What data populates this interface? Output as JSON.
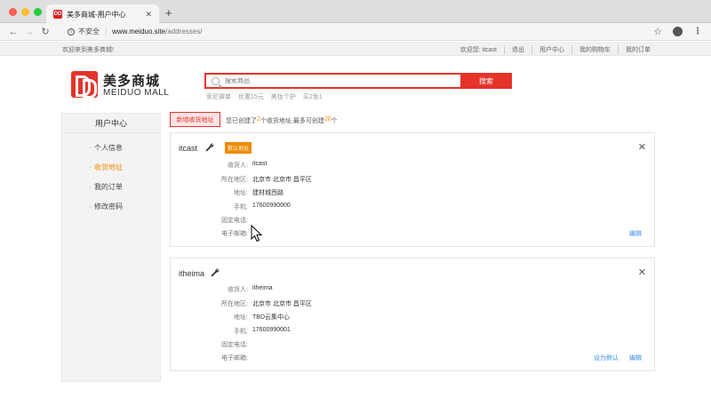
{
  "browser": {
    "tab_title": "美多商城-用户中心",
    "favicon_text": "DD",
    "insecure_label": "不安全",
    "url_host": "www.meiduo.site",
    "url_path": "/addresses/"
  },
  "topbar": {
    "welcome": "欢迎来到美多商城!",
    "greeting": "欢迎您: itcast",
    "logout": "退出",
    "user_center": "用户中心",
    "cart": "我的购物车",
    "orders": "我的订单"
  },
  "header": {
    "logo_cn": "美多商城",
    "logo_en": "MEIDUO MALL",
    "search_placeholder": "搜索商品",
    "search_button": "搜索",
    "hot_words": [
      "索尼微单",
      "优惠15元",
      "美妆个护",
      "买2免1"
    ]
  },
  "sidebar": {
    "title": "用户中心",
    "items": [
      {
        "label": "个人信息",
        "active": false
      },
      {
        "label": "收货地址",
        "active": true
      },
      {
        "label": "我的订单",
        "active": false
      },
      {
        "label": "修改密码",
        "active": false
      }
    ]
  },
  "main": {
    "add_button": "新增收货地址",
    "count_prefix": "您已创建了",
    "count_value": "2",
    "count_middle": "个收货地址,最多可创建",
    "count_max": "20",
    "count_suffix": "个"
  },
  "addresses": [
    {
      "name": "itcast",
      "default_badge": "默认地址",
      "labels": [
        "收货人:",
        "所在地区:",
        "地址:",
        "手机:",
        "固定电话:",
        "电子邮箱:"
      ],
      "values": [
        "itcast",
        "北京市 北京市 昌平区",
        "建材城西路",
        "17600990000",
        "",
        ""
      ],
      "actions": [
        "编辑"
      ]
    },
    {
      "name": "itheima",
      "default_badge": "",
      "labels": [
        "收货人:",
        "所在地区:",
        "地址:",
        "手机:",
        "固定电话:",
        "电子邮箱:"
      ],
      "values": [
        "itheima",
        "北京市 北京市 昌平区",
        "TBD云集中心",
        "17600990001",
        "",
        ""
      ],
      "actions": [
        "设为默认",
        "编辑"
      ]
    }
  ],
  "colors": {
    "brand_red": "#e5332a",
    "accent_orange": "#f08a00",
    "link_blue": "#3a8ee6"
  }
}
